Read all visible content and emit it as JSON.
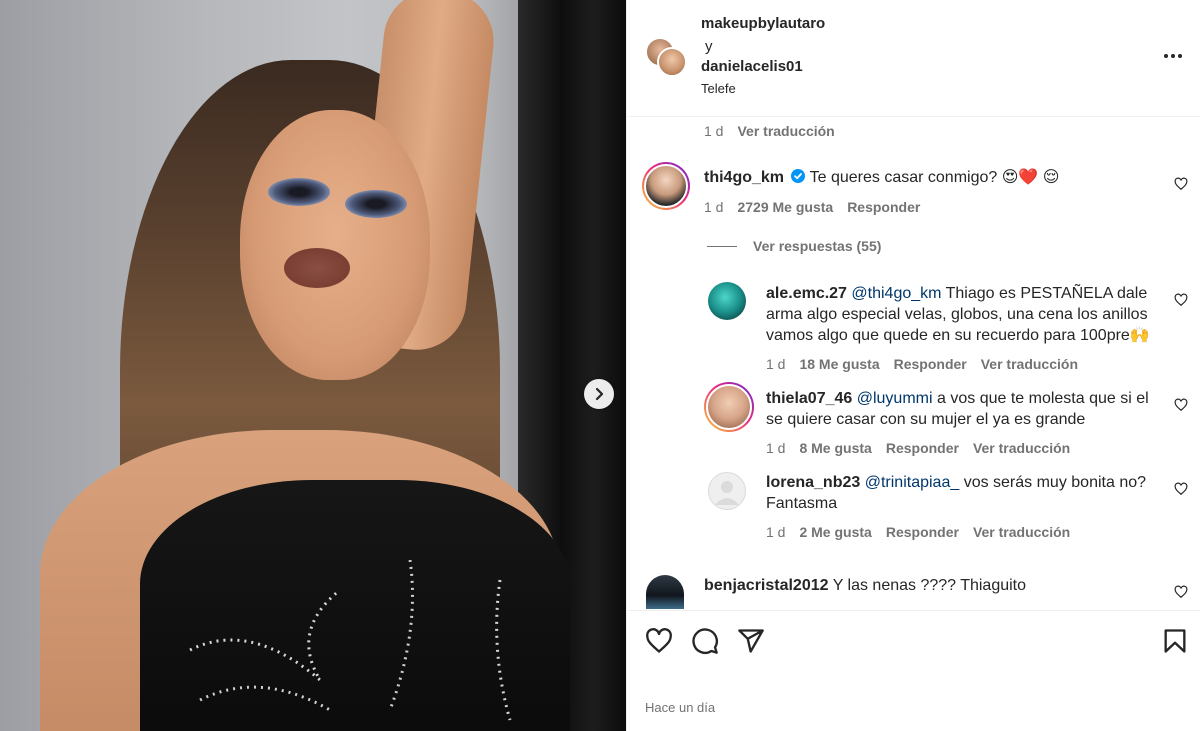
{
  "post": {
    "carousel_next_icon": "chevron-right-icon"
  },
  "header": {
    "user1": "makeupbylautaro",
    "and": "y",
    "user2": "danielacelis01",
    "location": "Telefe",
    "more_icon": "more-horizontal-icon"
  },
  "caption_meta": {
    "time": "1 d",
    "translate": "Ver traducción"
  },
  "comments": [
    {
      "user": "thi4go_km",
      "verified": true,
      "text": "Te queres casar conmigo? 😍❤️ 😌",
      "time": "1 d",
      "likes": "2729 Me gusta",
      "reply": "Responder",
      "view_replies": "Ver respuestas (55)"
    },
    {
      "user": "ale.emc.27",
      "mention": "@thi4go_km",
      "text": "Thiago es PESTAÑELA dale arma algo especial velas, globos, una cena los anillos vamos algo que quede en su recuerdo para 100pre🙌",
      "time": "1 d",
      "likes": "18 Me gusta",
      "reply": "Responder",
      "translate": "Ver traducción"
    },
    {
      "user": "thiela07_46",
      "mention": "@luyummi",
      "text": "a vos que te molesta que si el se quiere casar con su mujer el ya es grande",
      "time": "1 d",
      "likes": "8 Me gusta",
      "reply": "Responder",
      "translate": "Ver traducción"
    },
    {
      "user": "lorena_nb23",
      "mention": "@trinitapiaa_",
      "text": "vos serás muy bonita no? Fantasma",
      "time": "1 d",
      "likes": "2 Me gusta",
      "reply": "Responder",
      "translate": "Ver traducción"
    },
    {
      "user": "benjacristal2012",
      "text": "Y las nenas ???? Thiaguito"
    }
  ],
  "actions": {
    "like_icon": "heart-icon",
    "comment_icon": "comment-icon",
    "share_icon": "send-icon",
    "save_icon": "bookmark-icon"
  },
  "footer": {
    "time_ago": "Hace un día"
  },
  "colors": {
    "text": "#262626",
    "secondary": "#737373",
    "mention": "#00376b",
    "verified": "#0095f6",
    "divider": "#efefef"
  }
}
